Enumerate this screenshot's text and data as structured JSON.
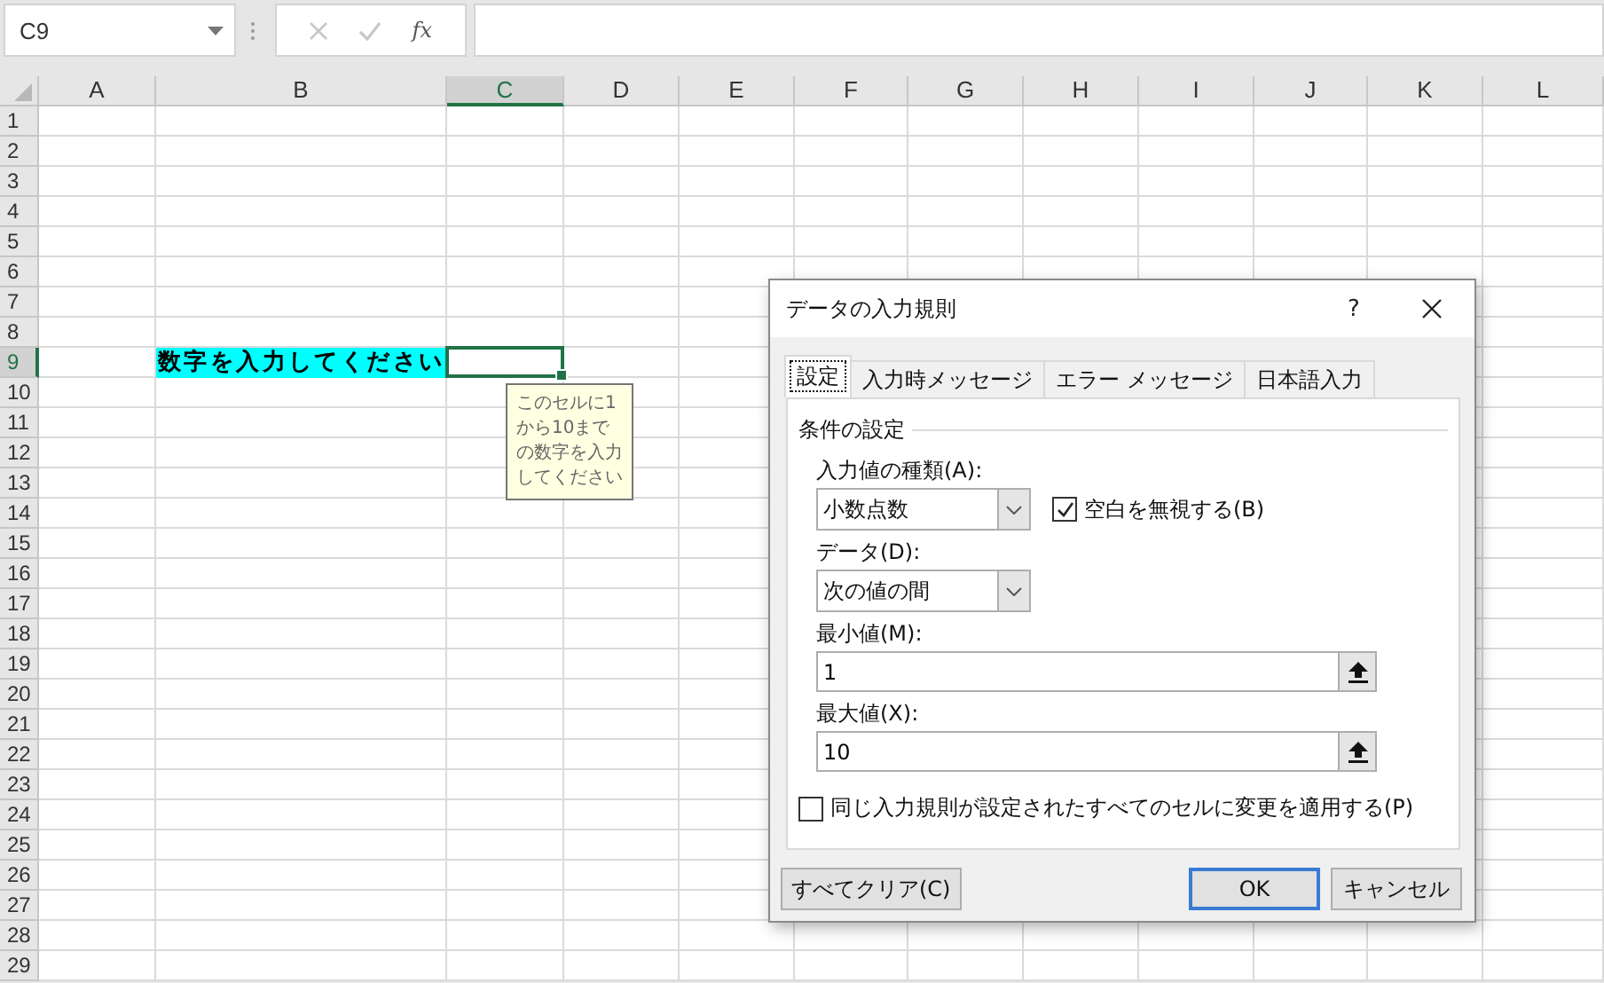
{
  "name_box": {
    "value": "C9"
  },
  "formula_bar": {
    "function_label": "fx"
  },
  "sheet": {
    "columns": [
      {
        "label": "A",
        "selected": false
      },
      {
        "label": "B",
        "selected": false
      },
      {
        "label": "C",
        "selected": true
      },
      {
        "label": "D",
        "selected": false
      },
      {
        "label": "E",
        "selected": false
      },
      {
        "label": "F",
        "selected": false
      },
      {
        "label": "G",
        "selected": false
      },
      {
        "label": "H",
        "selected": false
      },
      {
        "label": "I",
        "selected": false
      },
      {
        "label": "J",
        "selected": false
      },
      {
        "label": "K",
        "selected": false
      },
      {
        "label": "L",
        "selected": false
      }
    ],
    "rows": [
      {
        "label": "1",
        "selected": false
      },
      {
        "label": "2",
        "selected": false
      },
      {
        "label": "3",
        "selected": false
      },
      {
        "label": "4",
        "selected": false
      },
      {
        "label": "5",
        "selected": false
      },
      {
        "label": "6",
        "selected": false
      },
      {
        "label": "7",
        "selected": false
      },
      {
        "label": "8",
        "selected": false
      },
      {
        "label": "9",
        "selected": true
      },
      {
        "label": "10",
        "selected": false
      },
      {
        "label": "11",
        "selected": false
      },
      {
        "label": "12",
        "selected": false
      },
      {
        "label": "13",
        "selected": false
      },
      {
        "label": "14",
        "selected": false
      },
      {
        "label": "15",
        "selected": false
      },
      {
        "label": "16",
        "selected": false
      },
      {
        "label": "17",
        "selected": false
      },
      {
        "label": "18",
        "selected": false
      },
      {
        "label": "19",
        "selected": false
      },
      {
        "label": "20",
        "selected": false
      },
      {
        "label": "21",
        "selected": false
      },
      {
        "label": "22",
        "selected": false
      },
      {
        "label": "23",
        "selected": false
      },
      {
        "label": "24",
        "selected": false
      },
      {
        "label": "25",
        "selected": false
      },
      {
        "label": "26",
        "selected": false
      },
      {
        "label": "27",
        "selected": false
      },
      {
        "label": "28",
        "selected": false
      },
      {
        "label": "29",
        "selected": false
      }
    ],
    "cell_text": "数字を入力してください",
    "input_message": "このセルに1から10までの数字を入力してください"
  },
  "dialog": {
    "title": "データの入力規則",
    "help": "?",
    "tabs": [
      {
        "label": "設定",
        "selected": true
      },
      {
        "label": "入力時メッセージ",
        "selected": false
      },
      {
        "label": "エラー メッセージ",
        "selected": false
      },
      {
        "label": "日本語入力",
        "selected": false
      }
    ],
    "group_title": "条件の設定",
    "allow": {
      "label": "入力値の種類(A):",
      "value": "小数点数"
    },
    "ignore_blank": {
      "label": "空白を無視する(B)",
      "checked": true
    },
    "data": {
      "label": "データ(D):",
      "value": "次の値の間"
    },
    "minimum": {
      "label": "最小値(M):",
      "value": "1"
    },
    "maximum": {
      "label": "最大値(X):",
      "value": "10"
    },
    "apply_all": {
      "label": "同じ入力規則が設定されたすべてのセルに変更を適用する(P)",
      "checked": false
    },
    "buttons": [
      {
        "label": "すべてクリア(C)",
        "kind": "secondary"
      },
      {
        "label": "OK",
        "kind": "default"
      },
      {
        "label": "キャンセル",
        "kind": "normal"
      }
    ]
  }
}
